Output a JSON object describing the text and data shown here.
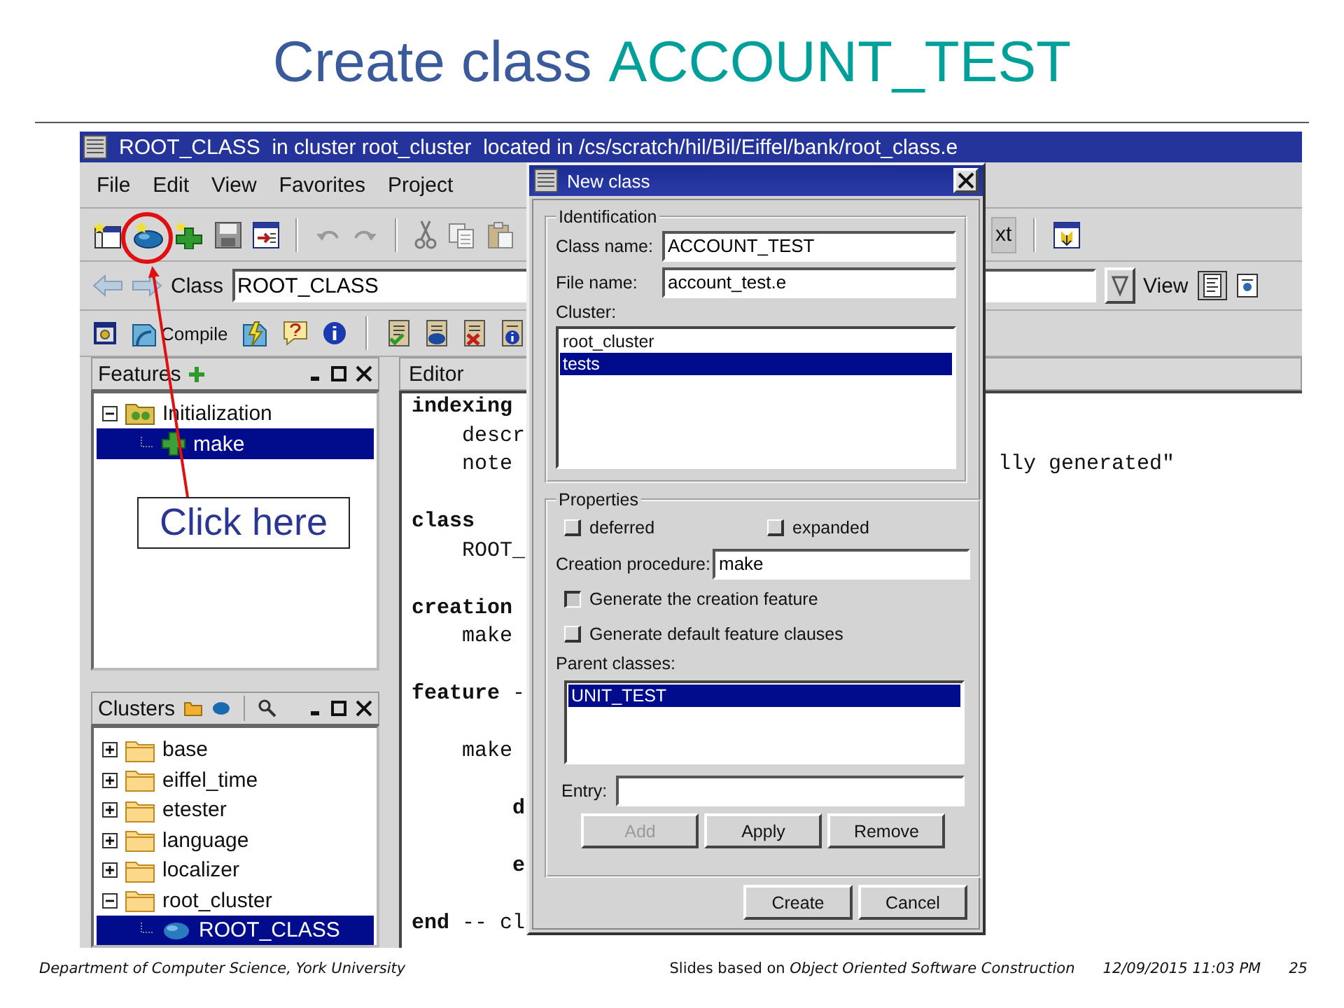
{
  "slide": {
    "title": "Create class",
    "title_highlight": "ACCOUNT_TEST"
  },
  "ide": {
    "window": {
      "title": "ROOT_CLASS  in cluster root_cluster  located in /cs/scratch/hil/Bil/Eiffel/bank/root_class.e"
    },
    "menu": [
      "File",
      "Edit",
      "View",
      "Favorites",
      "Project"
    ],
    "context_button": "xt",
    "class_bar": {
      "label": "Class",
      "value": "ROOT_CLASS",
      "view_label": "View"
    },
    "compile_button": "Compile",
    "features_panel": {
      "title": "Features",
      "tree": [
        {
          "label": "Initialization",
          "kind": "clause",
          "expanded": true,
          "selected": false,
          "children": [
            {
              "label": "make",
              "kind": "feature",
              "selected": true
            }
          ]
        }
      ]
    },
    "clusters_panel": {
      "title": "Clusters",
      "tree": [
        {
          "label": "base",
          "kind": "cluster",
          "expanded": false,
          "selected": false
        },
        {
          "label": "eiffel_time",
          "kind": "cluster",
          "expanded": false,
          "selected": false
        },
        {
          "label": "etester",
          "kind": "cluster",
          "expanded": false,
          "selected": false
        },
        {
          "label": "language",
          "kind": "cluster",
          "expanded": false,
          "selected": false
        },
        {
          "label": "localizer",
          "kind": "cluster",
          "expanded": false,
          "selected": false
        },
        {
          "label": "root_cluster",
          "kind": "cluster",
          "expanded": true,
          "selected": false,
          "children": [
            {
              "label": "ROOT_CLASS",
              "kind": "class",
              "selected": true
            }
          ]
        }
      ]
    },
    "editor": {
      "title": "Editor",
      "lines": [
        {
          "kind": "keyword",
          "text": "indexing"
        },
        {
          "kind": "plain",
          "text": "    descr"
        },
        {
          "kind": "plain",
          "text": "    note",
          "tail": "lly generated\""
        },
        {
          "kind": "blank"
        },
        {
          "kind": "keyword",
          "text": "class"
        },
        {
          "kind": "plain",
          "text": "    ROOT_"
        },
        {
          "kind": "blank"
        },
        {
          "kind": "keyword",
          "text": "creation"
        },
        {
          "kind": "plain",
          "text": "    make"
        },
        {
          "kind": "blank"
        },
        {
          "kind": "mixed",
          "text": "**feature** -"
        },
        {
          "kind": "blank"
        },
        {
          "kind": "plain",
          "text": "    make"
        },
        {
          "kind": "blank"
        },
        {
          "kind": "keyword",
          "text": "        d"
        },
        {
          "kind": "blank"
        },
        {
          "kind": "keyword",
          "text": "        e"
        },
        {
          "kind": "blank"
        },
        {
          "kind": "mixed",
          "text": "**end** -- cl"
        }
      ]
    }
  },
  "dialog": {
    "title": "New class",
    "identification": {
      "legend": "Identification",
      "class_name": {
        "label": "Class name:",
        "value": "ACCOUNT_TEST"
      },
      "file_name": {
        "label": "File name:",
        "value": "account_test.e"
      },
      "cluster_label": "Cluster:",
      "clusters": [
        {
          "label": "root_cluster",
          "selected": false
        },
        {
          "label": "tests",
          "selected": true
        }
      ]
    },
    "properties": {
      "legend": "Properties",
      "deferred": {
        "label": "deferred",
        "checked": false
      },
      "expanded": {
        "label": "expanded",
        "checked": false
      },
      "creation_procedure": {
        "label": "Creation procedure:",
        "value": "make"
      },
      "generate_creation": {
        "label": "Generate the creation feature",
        "checked": true
      },
      "generate_clauses": {
        "label": "Generate default feature clauses",
        "checked": false
      },
      "parent_label": "Parent classes:",
      "parents": [
        {
          "label": "UNIT_TEST",
          "selected": true
        }
      ],
      "entry_label": "Entry:",
      "buttons": [
        {
          "label": "Add",
          "disabled": true
        },
        {
          "label": "Apply",
          "disabled": false
        },
        {
          "label": "Remove",
          "disabled": false
        }
      ]
    },
    "buttons": [
      "Create",
      "Cancel"
    ]
  },
  "callout": {
    "text": "Click here"
  },
  "footer": {
    "department": "Department of Computer Science, York University",
    "credit": "Slides based on *Object Oriented Software Construction*",
    "date": "12/09/2015 11:03 PM",
    "page": "25"
  }
}
